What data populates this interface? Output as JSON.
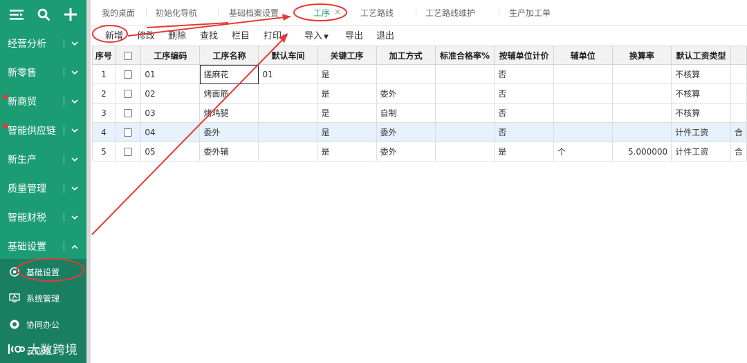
{
  "sidebar": {
    "modules": [
      {
        "label": "经营分析",
        "dot": false,
        "expanded": false
      },
      {
        "label": "新零售",
        "dot": false,
        "expanded": false
      },
      {
        "label": "新商贸",
        "dot": true,
        "expanded": false
      },
      {
        "label": "智能供应链",
        "dot": true,
        "expanded": false
      },
      {
        "label": "新生产",
        "dot": false,
        "expanded": false
      },
      {
        "label": "质量管理",
        "dot": false,
        "expanded": false
      },
      {
        "label": "智能财税",
        "dot": false,
        "expanded": false
      },
      {
        "label": "基础设置",
        "dot": false,
        "expanded": true
      }
    ],
    "subitems": [
      {
        "label": "基础设置",
        "icon": "gear-icon"
      },
      {
        "label": "系统管理",
        "icon": "monitor-icon"
      },
      {
        "label": "协同办公",
        "icon": "chat-icon"
      }
    ],
    "watermark": "大数跨境",
    "bottom_partial": "云应用"
  },
  "tabs": [
    {
      "label": "我的桌面",
      "active": false
    },
    {
      "label": "初始化导航",
      "active": false
    },
    {
      "label": "基础档案设置",
      "active": false
    },
    {
      "label": "工序",
      "active": true
    },
    {
      "label": "工艺路线",
      "active": false
    },
    {
      "label": "工艺路线维护",
      "active": false
    },
    {
      "label": "生产加工单",
      "active": false
    }
  ],
  "toolbar": {
    "add": "新增",
    "edit": "修改",
    "delete": "删除",
    "find": "查找",
    "columns": "栏目",
    "print": "打印",
    "import": "导入",
    "export": "导出",
    "exit": "退出"
  },
  "grid": {
    "headers": [
      "序号",
      "",
      "工序编码",
      "工序名称",
      "默认车间",
      "关键工序",
      "加工方式",
      "标准合格率%",
      "按辅单位计价",
      "辅单位",
      "换算率",
      "默认工资类型",
      ""
    ],
    "rows": [
      {
        "no": "1",
        "code": "01",
        "name": "搓麻花",
        "workshop": "01",
        "key": "是",
        "method": "",
        "rate": "",
        "aux_price": "否",
        "aux_unit": "",
        "conv": "",
        "wage": "不核算",
        "extra": ""
      },
      {
        "no": "2",
        "code": "02",
        "name": "烤面筋",
        "workshop": "",
        "key": "是",
        "method": "委外",
        "rate": "",
        "aux_price": "否",
        "aux_unit": "",
        "conv": "",
        "wage": "不核算",
        "extra": ""
      },
      {
        "no": "3",
        "code": "03",
        "name": "烤鸡腿",
        "workshop": "",
        "key": "是",
        "method": "自制",
        "rate": "",
        "aux_price": "否",
        "aux_unit": "",
        "conv": "",
        "wage": "不核算",
        "extra": ""
      },
      {
        "no": "4",
        "code": "04",
        "name": "委外",
        "workshop": "",
        "key": "是",
        "method": "委外",
        "rate": "",
        "aux_price": "否",
        "aux_unit": "",
        "conv": "",
        "wage": "计件工资",
        "extra": "合"
      },
      {
        "no": "5",
        "code": "05",
        "name": "委外辅",
        "workshop": "",
        "key": "是",
        "method": "委外",
        "rate": "",
        "aux_price": "是",
        "aux_unit": "个",
        "conv": "5.000000",
        "wage": "计件工资",
        "extra": "合"
      }
    ]
  },
  "colors": {
    "sidebar": "#1c9c72",
    "submenu": "#1a7f61",
    "accent": "#1c9c72",
    "annotation": "#e53935",
    "highlight_row": "#e6f1fb"
  }
}
